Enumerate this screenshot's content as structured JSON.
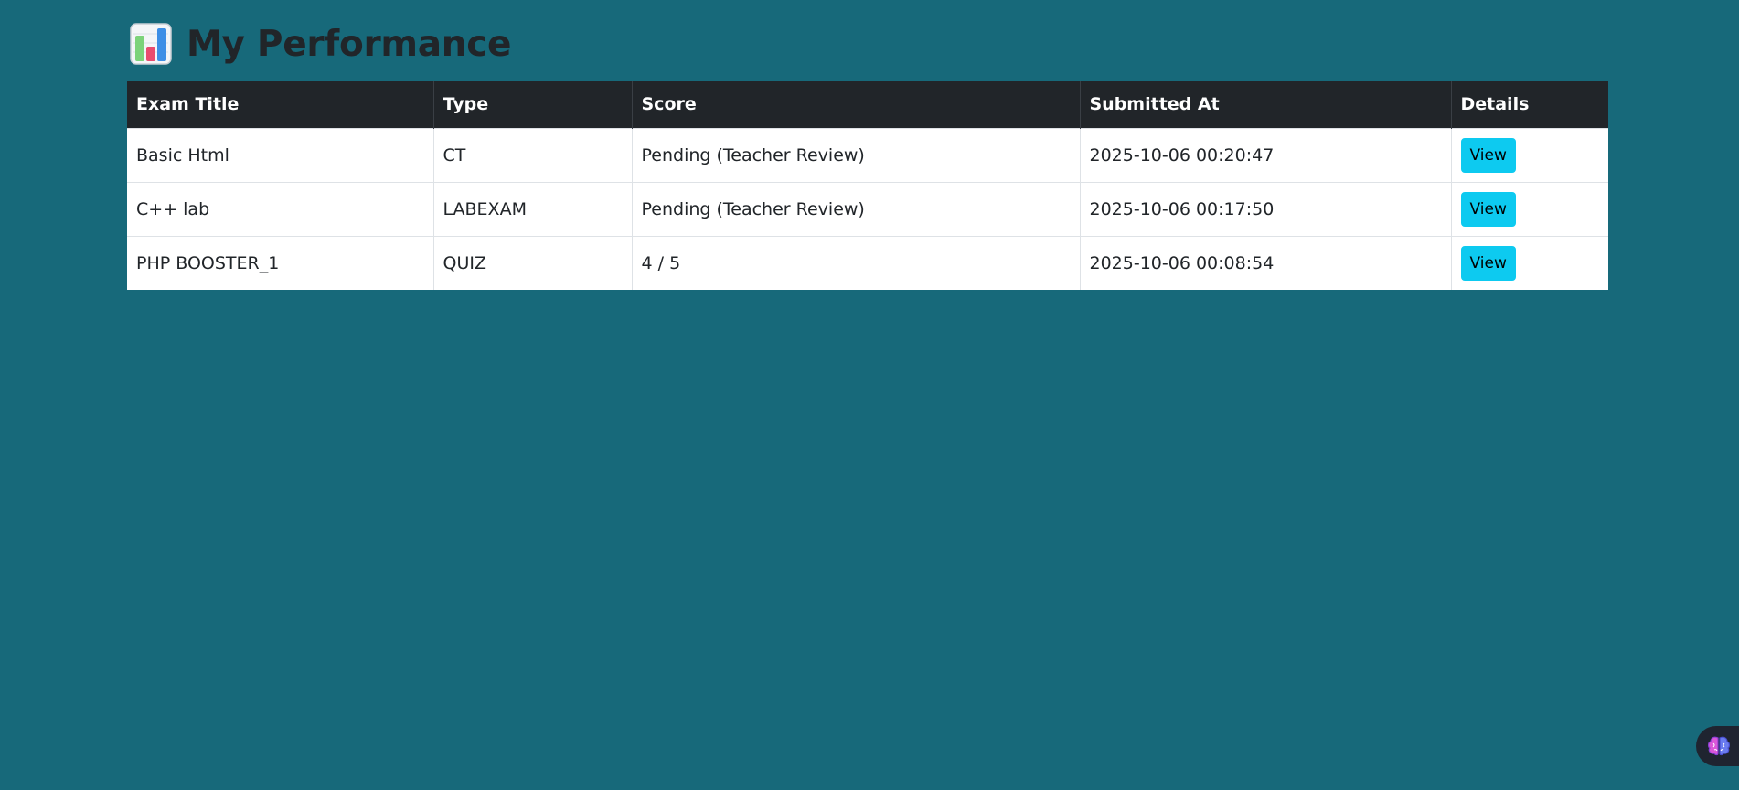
{
  "page": {
    "title": "My Performance",
    "title_icon": "bar-chart-icon"
  },
  "table": {
    "headers": {
      "exam_title": "Exam Title",
      "type": "Type",
      "score": "Score",
      "submitted_at": "Submitted At",
      "details": "Details"
    },
    "rows": [
      {
        "exam_title": "Basic Html",
        "type": "CT",
        "score": "Pending (Teacher Review)",
        "submitted_at": "2025-10-06 00:20:47",
        "action": "View"
      },
      {
        "exam_title": "C++ lab",
        "type": "LABEXAM",
        "score": "Pending (Teacher Review)",
        "submitted_at": "2025-10-06 00:17:50",
        "action": "View"
      },
      {
        "exam_title": "PHP BOOSTER_1",
        "type": "QUIZ",
        "score": "4 / 5",
        "submitted_at": "2025-10-06 00:08:54",
        "action": "View"
      }
    ]
  },
  "assistant": {
    "icon": "brain-icon"
  },
  "colors": {
    "background": "#17697a",
    "header_bg": "#212529",
    "button": "#0dcaf0"
  }
}
